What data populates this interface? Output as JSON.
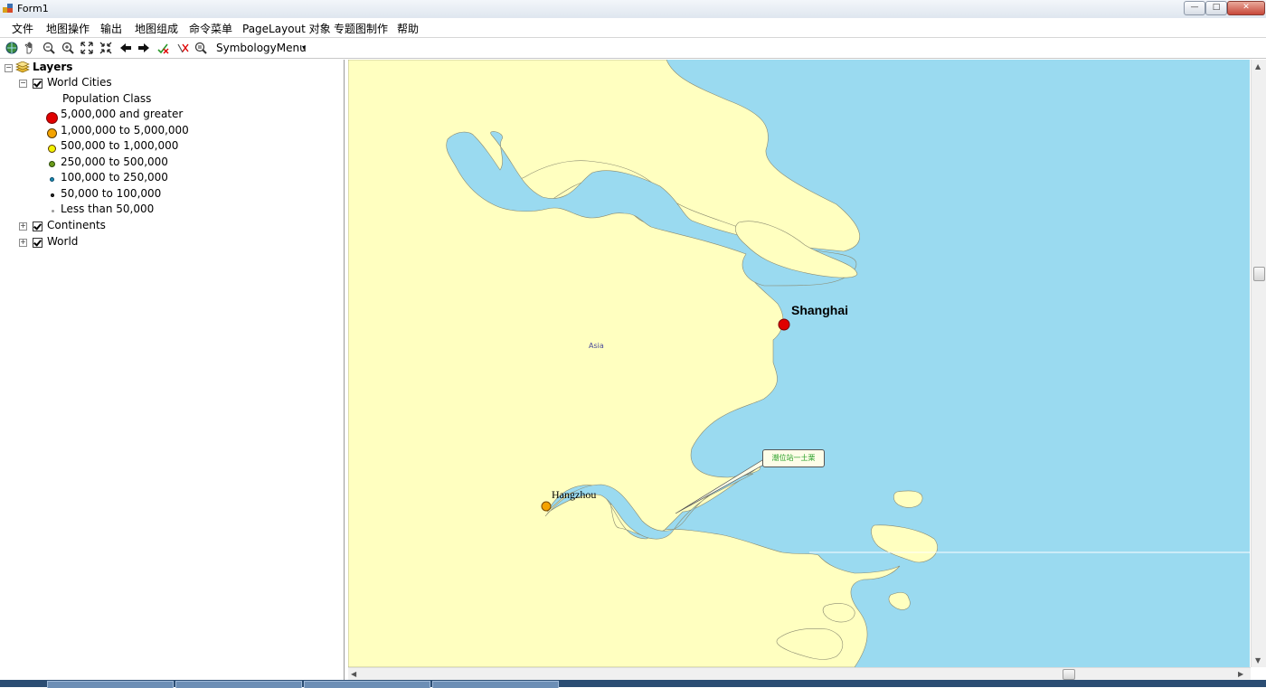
{
  "window": {
    "title": "Form1",
    "controls": [
      "—",
      "□",
      "✕"
    ]
  },
  "menu": {
    "items": [
      "文件",
      "地图操作",
      "输出",
      "地图组成",
      "命令菜单",
      "PageLayout 对象",
      "专题图制作",
      "帮助"
    ]
  },
  "toolbar": {
    "tools": [
      "globe-icon",
      "pan-icon",
      "zoom-out-icon",
      "zoom-in-icon",
      "full-extent-icon",
      "fixed-zoom-icon",
      "back-icon",
      "forward-icon",
      "select-icon",
      "clear-select-icon",
      "identify-icon"
    ],
    "symbology_menu": "SymbologyMenu",
    "dropdown_arrow": "▾"
  },
  "toc": {
    "root": "Layers",
    "layers": [
      {
        "name": "World Cities",
        "expanded": true,
        "checked": true,
        "legend_heading": "Population Class",
        "classes": [
          {
            "label": "5,000,000 and greater",
            "color": "#e00000",
            "size": 11
          },
          {
            "label": "1,000,000 to 5,000,000",
            "color": "#f4a300",
            "size": 9
          },
          {
            "label": "500,000 to 1,000,000",
            "color": "#f2f200",
            "size": 7
          },
          {
            "label": "250,000 to 500,000",
            "color": "#6a9a1a",
            "size": 6
          },
          {
            "label": "100,000 to 250,000",
            "color": "#1a8ab0",
            "size": 4
          },
          {
            "label": "50,000 to 100,000",
            "color": "#303030",
            "size": 3
          },
          {
            "label": "Less than 50,000",
            "color": "#9a9a9a",
            "size": 2
          }
        ]
      },
      {
        "name": "Continents",
        "expanded": false,
        "checked": true
      },
      {
        "name": "World",
        "expanded": false,
        "checked": true
      }
    ]
  },
  "map": {
    "land_color": "#ffffc0",
    "water_color": "#9adaf0",
    "cities": [
      {
        "name": "Shanghai",
        "color": "#e00000"
      },
      {
        "name": "Hangzhou",
        "color": "#f4a300"
      }
    ],
    "continent_label": "Asia",
    "callout_text": "潮位站一土栗"
  }
}
